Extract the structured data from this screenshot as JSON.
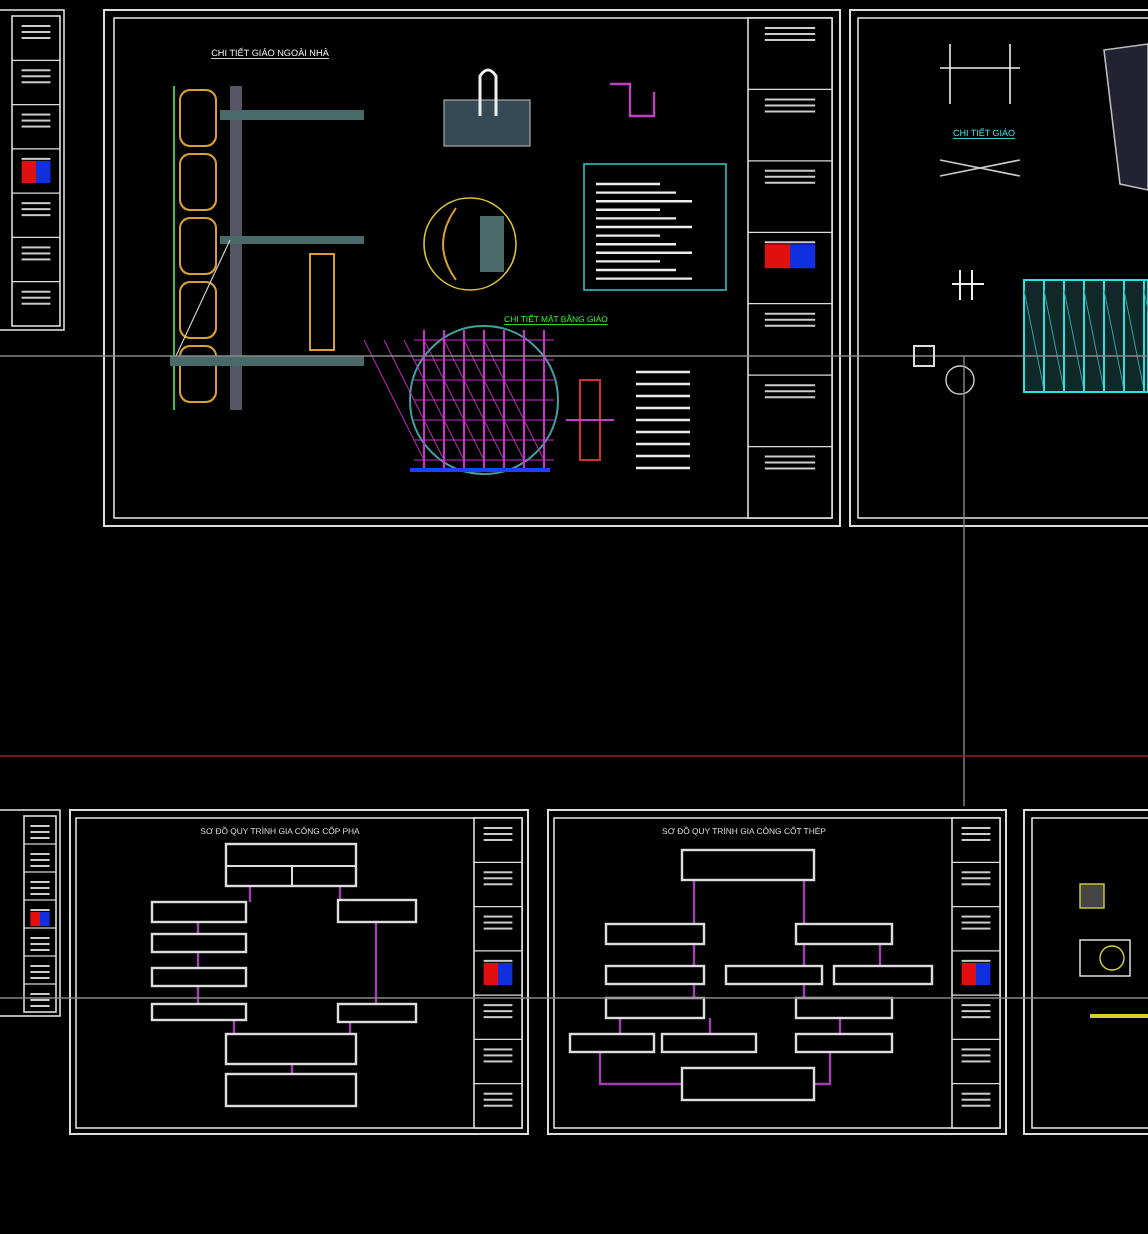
{
  "detail_sheet": {
    "titles": [
      "CHI TIẾT GIÁO NGOÀI NHÀ",
      "CHI TIẾT MẶT BẰNG GIÁO"
    ]
  },
  "right_sheet": {
    "title": "CHI TIẾT GIÁO"
  },
  "flowcharts": [
    {
      "kind": "formwork",
      "title": "SƠ ĐỒ QUY TRÌNH GIA CÔNG CỐP PHA"
    },
    {
      "kind": "rebar",
      "title": "SƠ ĐỒ QUY TRÌNH GIA CÔNG CỐT THÉP"
    }
  ]
}
